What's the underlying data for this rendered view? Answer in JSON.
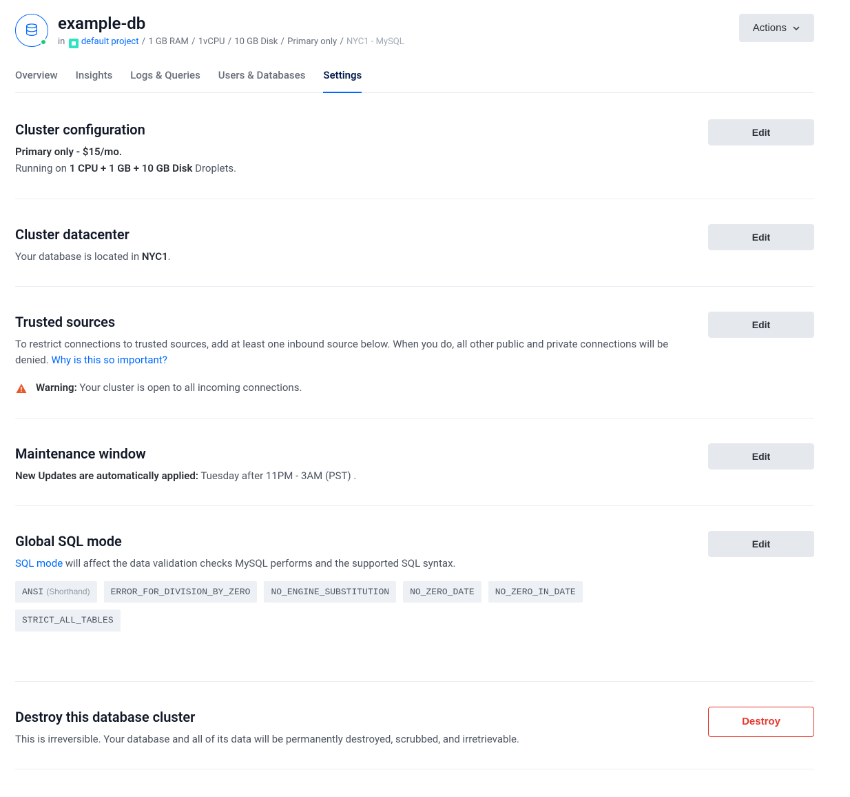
{
  "header": {
    "title": "example-db",
    "in_label": "in",
    "project_name": "default project",
    "specs": [
      "1 GB RAM",
      "1vCPU",
      "10 GB Disk",
      "Primary only"
    ],
    "region_engine": "NYC1 - MySQL",
    "actions_label": "Actions"
  },
  "tabs": [
    {
      "label": "Overview",
      "active": false
    },
    {
      "label": "Insights",
      "active": false
    },
    {
      "label": "Logs & Queries",
      "active": false
    },
    {
      "label": "Users & Databases",
      "active": false
    },
    {
      "label": "Settings",
      "active": true
    }
  ],
  "sections": {
    "cluster_config": {
      "title": "Cluster configuration",
      "lead": "Primary only - $15/mo.",
      "running_prefix": "Running on ",
      "running_bold": "1 CPU + 1 GB + 10 GB Disk",
      "running_suffix": " Droplets.",
      "edit": "Edit"
    },
    "datacenter": {
      "title": "Cluster datacenter",
      "prefix": "Your database is located in ",
      "region": "NYC1",
      "suffix": ".",
      "edit": "Edit"
    },
    "trusted": {
      "title": "Trusted sources",
      "desc": "To restrict connections to trusted sources, add at least one inbound source below. When you do, all other public and private connections will be denied. ",
      "link": "Why is this so important?",
      "warn_label": "Warning:",
      "warn_text": " Your cluster is open to all incoming connections.",
      "edit": "Edit"
    },
    "maintenance": {
      "title": "Maintenance window",
      "lead": "New Updates are automatically applied:",
      "schedule": " Tuesday after 11PM - 3AM (PST) .",
      "edit": "Edit"
    },
    "sqlmode": {
      "title": "Global SQL mode",
      "link": "SQL mode",
      "desc_suffix": " will affect the data validation checks MySQL performs and the supported SQL syntax.",
      "tags": [
        {
          "name": "ANSI",
          "shorthand": "(Shorthand)"
        },
        {
          "name": "ERROR_FOR_DIVISION_BY_ZERO"
        },
        {
          "name": "NO_ENGINE_SUBSTITUTION"
        },
        {
          "name": "NO_ZERO_DATE"
        },
        {
          "name": "NO_ZERO_IN_DATE"
        },
        {
          "name": "STRICT_ALL_TABLES"
        }
      ],
      "edit": "Edit"
    },
    "destroy": {
      "title": "Destroy this database cluster",
      "desc": "This is irreversible. Your database and all of its data will be permanently destroyed, scrubbed, and irretrievable.",
      "button": "Destroy"
    }
  }
}
